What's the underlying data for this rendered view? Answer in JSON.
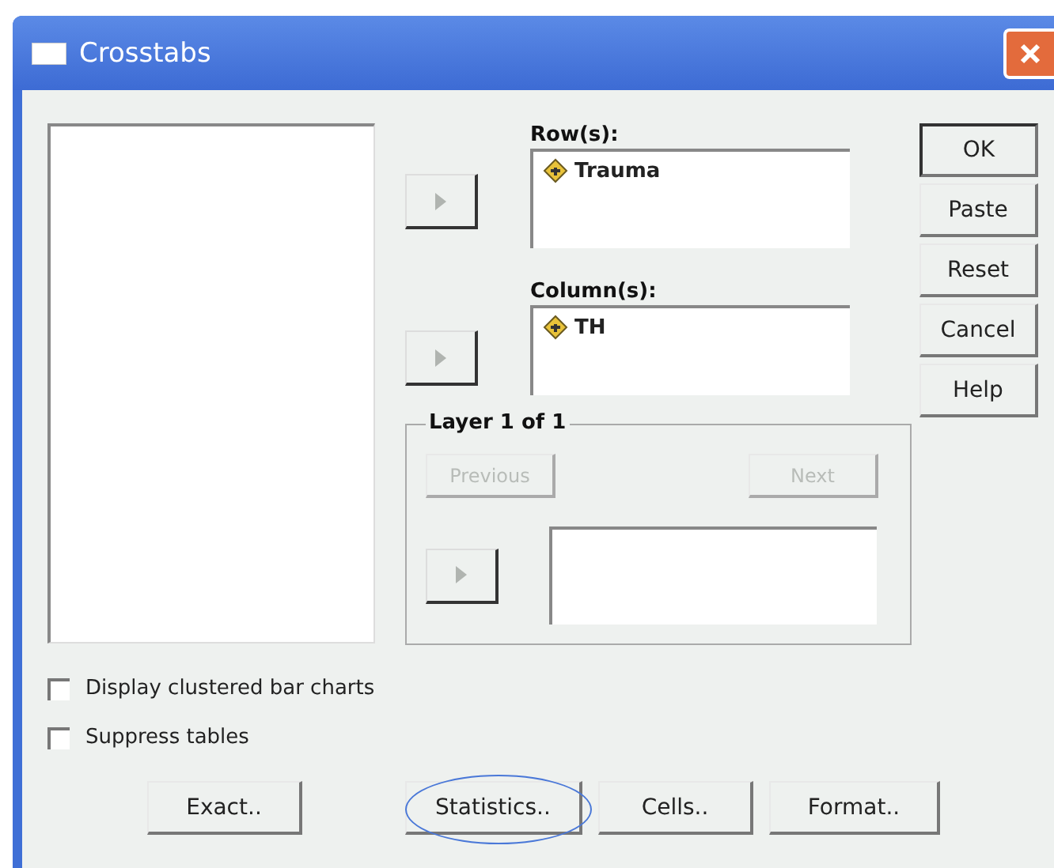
{
  "window": {
    "title": "Crosstabs"
  },
  "rows": {
    "label": "Row(s):",
    "items": [
      {
        "name": "Trauma"
      }
    ]
  },
  "columns": {
    "label": "Column(s):",
    "items": [
      {
        "name": "TH"
      }
    ]
  },
  "layer": {
    "label": "Layer 1 of 1",
    "buttons": [
      {
        "label": "Previous",
        "disabled": true
      },
      {
        "label": "Next",
        "disabled": true
      }
    ]
  },
  "side_buttons": [
    {
      "label": "OK",
      "default": true
    },
    {
      "label": "Paste",
      "default": false
    },
    {
      "label": "Reset",
      "default": false
    },
    {
      "label": "Cancel",
      "default": false
    },
    {
      "label": "Help",
      "default": false
    }
  ],
  "checkboxes": [
    {
      "label": "Display clustered bar charts",
      "checked": false
    },
    {
      "label": "Suppress tables",
      "checked": false
    }
  ],
  "bottom_buttons": [
    {
      "label": "Exact..",
      "highlighted": false
    },
    {
      "label": "Statistics..",
      "highlighted": true
    },
    {
      "label": "Cells..",
      "highlighted": false
    },
    {
      "label": "Format..",
      "highlighted": false
    }
  ]
}
